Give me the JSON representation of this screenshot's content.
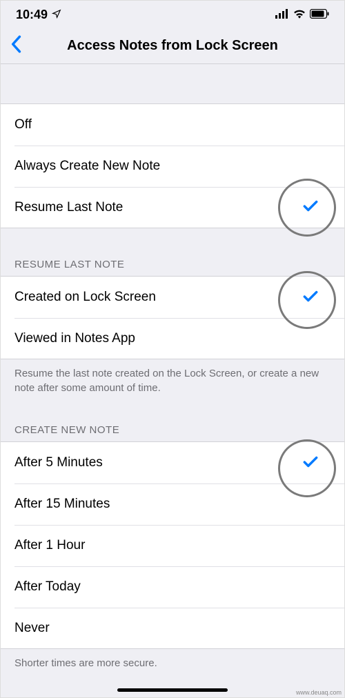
{
  "status": {
    "time": "10:49"
  },
  "nav": {
    "title": "Access Notes from Lock Screen"
  },
  "section1": {
    "items": [
      {
        "label": "Off",
        "selected": false
      },
      {
        "label": "Always Create New Note",
        "selected": false
      },
      {
        "label": "Resume Last Note",
        "selected": true
      }
    ]
  },
  "section2": {
    "header": "RESUME LAST NOTE",
    "items": [
      {
        "label": "Created on Lock Screen",
        "selected": true
      },
      {
        "label": "Viewed in Notes App",
        "selected": false
      }
    ],
    "footer": "Resume the last note created on the Lock Screen, or create a new note after some amount of time."
  },
  "section3": {
    "header": "CREATE NEW NOTE",
    "items": [
      {
        "label": "After 5 Minutes",
        "selected": true
      },
      {
        "label": "After 15 Minutes",
        "selected": false
      },
      {
        "label": "After 1 Hour",
        "selected": false
      },
      {
        "label": "After Today",
        "selected": false
      },
      {
        "label": "Never",
        "selected": false
      }
    ],
    "footer": "Shorter times are more secure."
  },
  "watermark": "www.deuaq.com"
}
